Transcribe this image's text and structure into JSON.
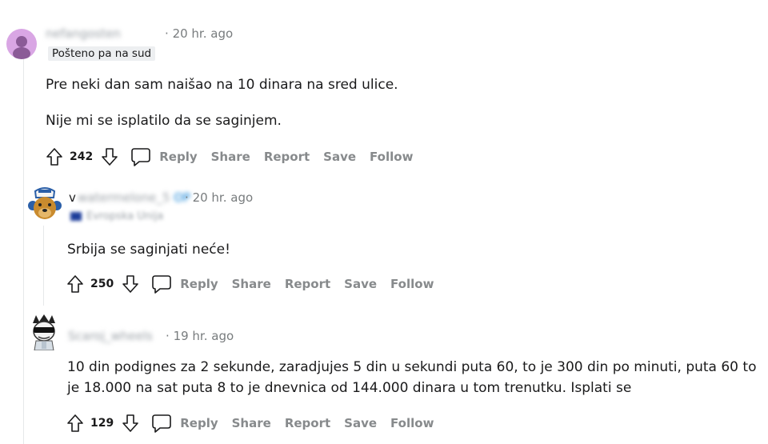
{
  "comments": [
    {
      "author": "nefangosten",
      "time_sep": "·",
      "time": "20 hr. ago",
      "flair": "Pošteno pa na sud",
      "body": [
        "Pre neki dan sam naišao na 10 dinara na sred ulice.",
        "Nije mi se isplatilo da se saginjem."
      ],
      "score": "242",
      "actions": {
        "reply": "Reply",
        "share": "Share",
        "report": "Report",
        "save": "Save",
        "follow": "Follow"
      }
    },
    {
      "author_initial": "v",
      "author": "watermelone_5",
      "op_badge": "OP",
      "time_sep": "·",
      "time": "20 hr. ago",
      "flair": "Evropska Unija",
      "body": [
        "Srbija se saginjati neće!"
      ],
      "score": "250",
      "actions": {
        "reply": "Reply",
        "share": "Share",
        "report": "Report",
        "save": "Save",
        "follow": "Follow"
      }
    },
    {
      "author": "Scaroj_wheels",
      "time_sep": "·",
      "time": "19 hr. ago",
      "body": [
        "10 din podignes za 2 sekunde, zaradjujes 5 din u sekundi puta 60, to je 300 din po minuti, puta 60 to je 18.000 na sat puta 8 to je dnevnica od 144.000 dinara u tom trenutku. Isplati se"
      ],
      "score": "129",
      "actions": {
        "reply": "Reply",
        "share": "Share",
        "report": "Report",
        "save": "Save",
        "follow": "Follow"
      }
    }
  ],
  "icons": {
    "upvote": "arrow-up-outline",
    "downvote": "arrow-down-outline",
    "reply": "speech-bubble-outline"
  },
  "colors": {
    "meta": "#787c7e",
    "action": "#878a8c",
    "flair_bg": "#edeff1",
    "thread_line": "#e6e8ea",
    "avatar1": "#d9a6e4"
  }
}
